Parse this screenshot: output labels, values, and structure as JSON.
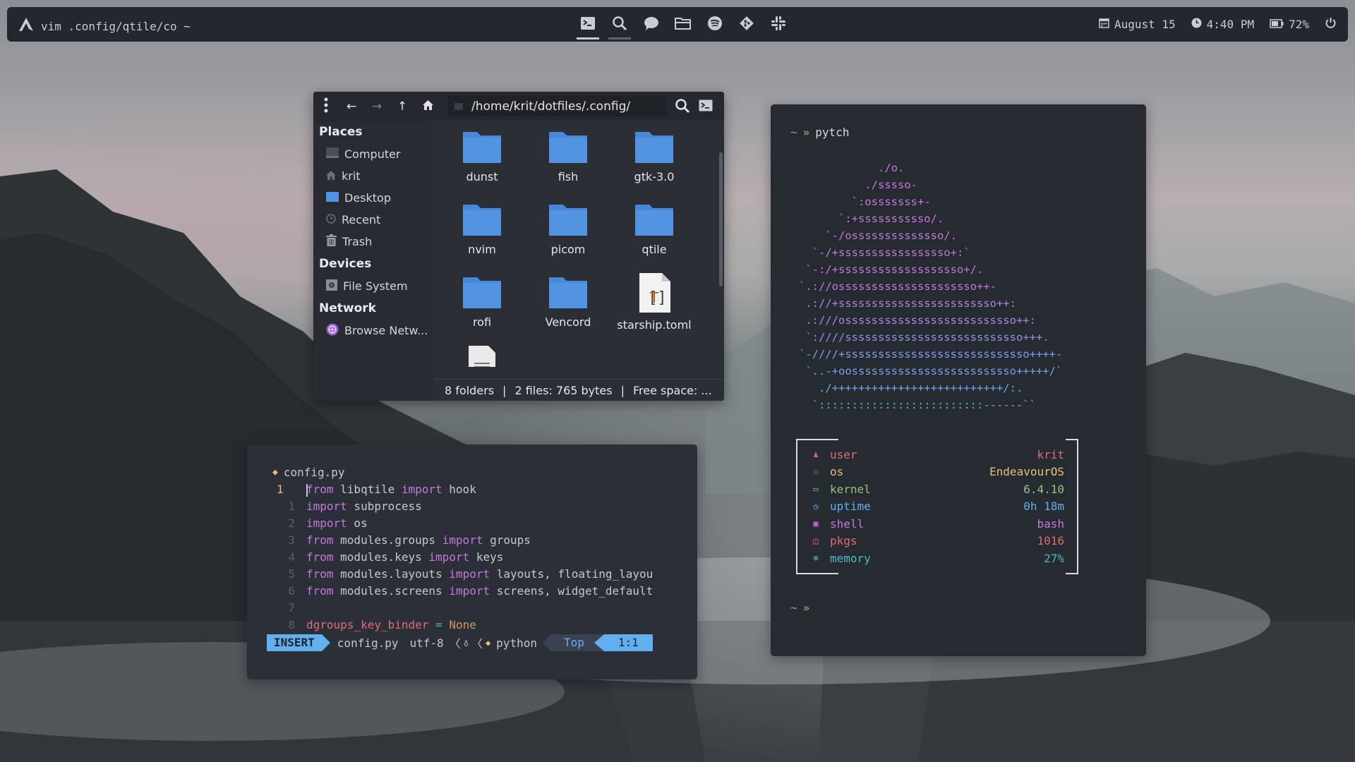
{
  "topbar": {
    "window_title": "vim .config/qtile/co ~",
    "center_icons": [
      "terminal-icon",
      "search-icon",
      "chat-icon",
      "folder-icon",
      "spotify-icon",
      "git-icon",
      "slack-icon"
    ],
    "date": "August 15",
    "time": "4:40 PM",
    "battery": "72%"
  },
  "file_manager": {
    "path": "/home/krit/dotfiles/.config/",
    "places_heading": "Places",
    "places": [
      "Computer",
      "krit",
      "Desktop",
      "Recent",
      "Trash"
    ],
    "devices_heading": "Devices",
    "devices": [
      "File System"
    ],
    "network_heading": "Network",
    "network": [
      "Browse Netw..."
    ],
    "files": [
      {
        "name": "dunst",
        "type": "folder"
      },
      {
        "name": "fish",
        "type": "folder"
      },
      {
        "name": "gtk-3.0",
        "type": "folder"
      },
      {
        "name": "nvim",
        "type": "folder"
      },
      {
        "name": "picom",
        "type": "folder"
      },
      {
        "name": "qtile",
        "type": "folder"
      },
      {
        "name": "rofi",
        "type": "folder"
      },
      {
        "name": "Vencord",
        "type": "folder"
      },
      {
        "name": "starship.toml",
        "type": "text"
      },
      {
        "name": "",
        "type": "document"
      }
    ],
    "status": {
      "folders": "8 folders",
      "files": "2 files: 765 bytes",
      "free": "Free space: ..."
    },
    "colors": {
      "folder": "#5294e2"
    }
  },
  "vim": {
    "filename": "config.py",
    "lines": [
      {
        "num": "1",
        "current": true,
        "tokens": [
          [
            "kw",
            "from"
          ],
          [
            "n",
            " libqtile "
          ],
          [
            "kw",
            "import"
          ],
          [
            "n",
            " hook"
          ]
        ]
      },
      {
        "num": "1",
        "tokens": [
          [
            "kw",
            "import"
          ],
          [
            "n",
            " subprocess"
          ]
        ]
      },
      {
        "num": "2",
        "tokens": [
          [
            "kw",
            "import"
          ],
          [
            "n",
            " os"
          ]
        ]
      },
      {
        "num": "3",
        "tokens": [
          [
            "kw",
            "from"
          ],
          [
            "n",
            " modules.groups "
          ],
          [
            "kw",
            "import"
          ],
          [
            "n",
            " groups"
          ]
        ]
      },
      {
        "num": "4",
        "tokens": [
          [
            "kw",
            "from"
          ],
          [
            "n",
            " modules.keys "
          ],
          [
            "kw",
            "import"
          ],
          [
            "n",
            " keys"
          ]
        ]
      },
      {
        "num": "5",
        "tokens": [
          [
            "kw",
            "from"
          ],
          [
            "n",
            " modules.layouts "
          ],
          [
            "kw",
            "import"
          ],
          [
            "n",
            " layouts, floating_layou"
          ]
        ]
      },
      {
        "num": "6",
        "tokens": [
          [
            "kw",
            "from"
          ],
          [
            "n",
            " modules.screens "
          ],
          [
            "kw",
            "import"
          ],
          [
            "n",
            " screens, widget_default"
          ]
        ]
      },
      {
        "num": "7",
        "tokens": []
      },
      {
        "num": "8",
        "tokens": [
          [
            "vr",
            "dgroups_key_binder"
          ],
          [
            "n",
            " "
          ],
          [
            "op",
            "="
          ],
          [
            "n",
            " "
          ],
          [
            "nn",
            "None"
          ]
        ]
      }
    ],
    "status": {
      "mode": "INSERT",
      "file": "config.py",
      "encoding": "utf-8",
      "lang": "python",
      "scroll": "Top",
      "position": "1:1"
    }
  },
  "terminal": {
    "command": "pytch",
    "prompt_tilde": "~",
    "prompt_arrow": "»",
    "art": [
      "            ./o.",
      "          ./sssso-",
      "        `:osssssss+-",
      "      `:+sssssssssso/.",
      "    `-/ossssssssssssso/.",
      "  `-/+sssssssssssssssso+:`",
      " `-:/+sssssssssssssssssso+/.",
      "`.://osssssssssssssssssssso++-",
      " .://+ssssssssssssssssssssssso++:",
      " .:///ossssssssssssssssssssssssso++:",
      " `:////sssssssssssssssssssssssssso+++.",
      "`-////+ssssssssssssssssssssssssssso++++-",
      " `..-+oosssssssssssssssssssssssso+++++/`",
      "   ./++++++++++++++++++++++++++/:.",
      "  `:::::::::::::::::::::::::------``"
    ],
    "info": [
      {
        "icon": "user-icon",
        "glyph": "♟",
        "label": "user",
        "value": "krit",
        "color": "#e06c75"
      },
      {
        "icon": "os-icon",
        "glyph": "♧",
        "label": "os",
        "value": "EndeavourOS",
        "color": "#e5c07b"
      },
      {
        "icon": "kernel-icon",
        "glyph": "▭",
        "label": "kernel",
        "value": "6.4.10",
        "color": "#98c379"
      },
      {
        "icon": "uptime-icon",
        "glyph": "◷",
        "label": "uptime",
        "value": "0h 18m",
        "color": "#61afef"
      },
      {
        "icon": "shell-icon",
        "glyph": "▣",
        "label": "shell",
        "value": "bash",
        "color": "#c678dd"
      },
      {
        "icon": "pkgs-icon",
        "glyph": "◫",
        "label": "pkgs",
        "value": "1016",
        "color": "#e06c75"
      },
      {
        "icon": "memory-icon",
        "glyph": "⊛",
        "label": "memory",
        "value": "27%",
        "color": "#56b6c2"
      }
    ]
  }
}
